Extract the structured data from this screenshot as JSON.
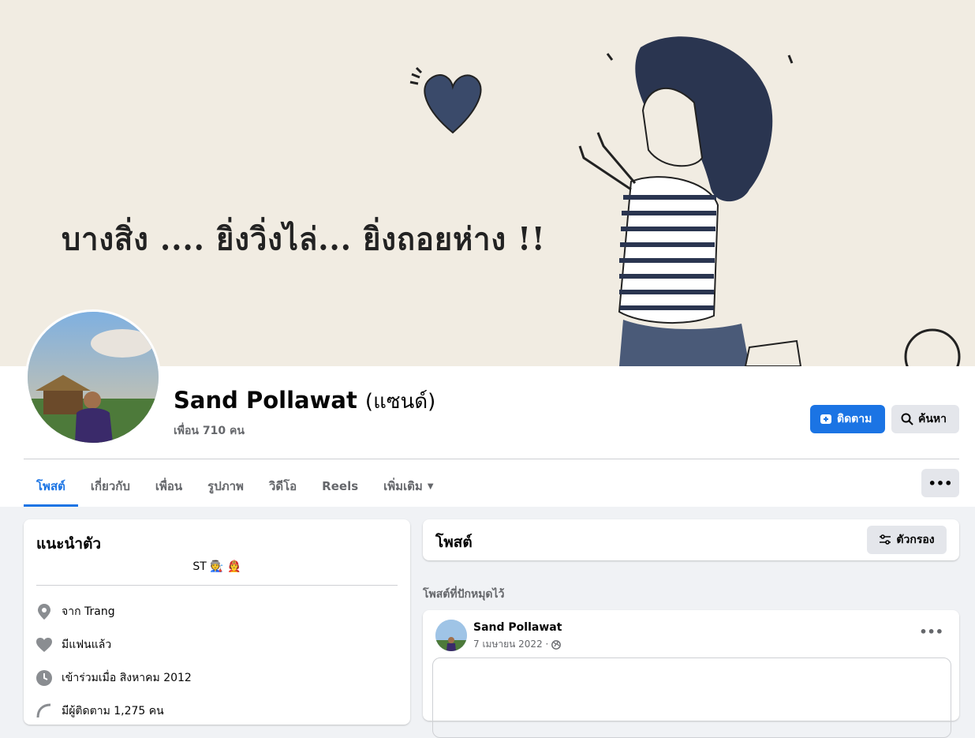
{
  "cover": {
    "text": "บางสิ่ง .... ยิ่งวิ่งไล่... ยิ่งถอยห่าง !!"
  },
  "profile": {
    "name": "Sand Pollawat",
    "alt_name": "(แซนด์)",
    "friends": "เพื่อน 710 คน"
  },
  "actions": {
    "follow": "ติดตาม",
    "search": "ค้นหา"
  },
  "tabs": [
    {
      "label": "โพสต์",
      "active": true
    },
    {
      "label": "เกี่ยวกับ"
    },
    {
      "label": "เพื่อน"
    },
    {
      "label": "รูปภาพ"
    },
    {
      "label": "วิดีโอ"
    },
    {
      "label": "Reels"
    },
    {
      "label": "เพิ่มเติม"
    }
  ],
  "intro": {
    "title": "แนะนำตัว",
    "bio": "ST 🧑‍🏭 🧑‍🚒",
    "from": "จาก Trang",
    "relationship": "มีแฟนแล้ว",
    "joined": "เข้าร่วมเมื่อ สิงหาคม 2012",
    "followers": "มีผู้ติดตาม 1,275 คน"
  },
  "posts": {
    "title": "โพสต์",
    "filter": "ตัวกรอง",
    "pinned_label": "โพสต์ที่ปักหมุดไว้",
    "pinned_post": {
      "author": "Sand Pollawat",
      "date": "7 เมษายน 2022 ·"
    }
  },
  "colors": {
    "accent": "#1b74e4",
    "background": "#f0f2f5",
    "secondary_text": "#65676b"
  }
}
